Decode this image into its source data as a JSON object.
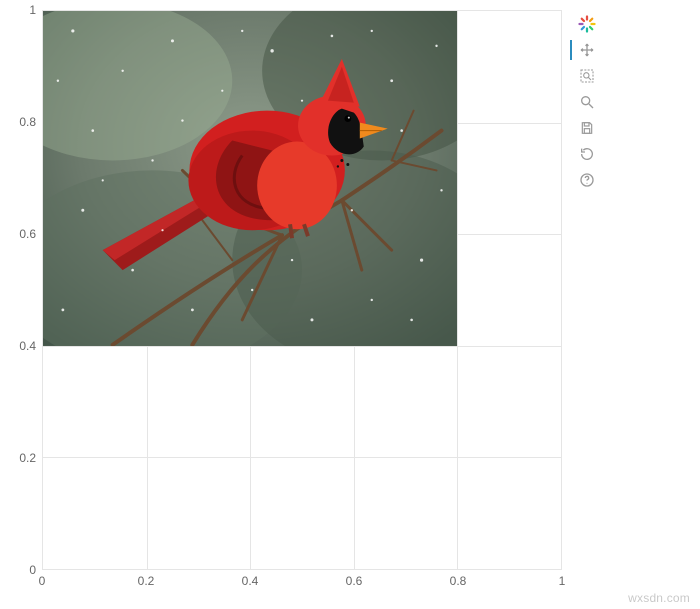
{
  "chart_data": {
    "type": "image",
    "title": "",
    "xlabel": "",
    "ylabel": "",
    "xlim": [
      0,
      1
    ],
    "ylim": [
      0,
      1
    ],
    "x_ticks": [
      0,
      0.2,
      0.4,
      0.6,
      0.8,
      1
    ],
    "y_ticks": [
      0,
      0.2,
      0.4,
      0.6,
      0.8,
      1
    ],
    "x_tick_labels": [
      "0",
      "0.2",
      "0.4",
      "0.6",
      "0.8",
      "1"
    ],
    "y_tick_labels": [
      "0",
      "0.2",
      "0.4",
      "0.6",
      "0.8",
      "1"
    ],
    "image_glyph": {
      "x": 0,
      "y": 0.4,
      "dw": 0.8,
      "dh": 0.6,
      "description": "Photograph of a bright red male Northern Cardinal with orange beak and black face mask, perched on bare brown twigs during snowfall against a blurred grey-green winter background."
    }
  },
  "toolbar": {
    "logo_name": "bokeh-logo",
    "tools": [
      {
        "name": "pan-tool",
        "label": "Pan",
        "active": true
      },
      {
        "name": "box-zoom-tool",
        "label": "Box Zoom",
        "active": false
      },
      {
        "name": "wheel-zoom-tool",
        "label": "Wheel Zoom",
        "active": false
      },
      {
        "name": "save-tool",
        "label": "Save",
        "active": false
      },
      {
        "name": "reset-tool",
        "label": "Reset",
        "active": false
      },
      {
        "name": "help-tool",
        "label": "Help",
        "active": false
      }
    ]
  },
  "watermark": "wxsdn.com"
}
